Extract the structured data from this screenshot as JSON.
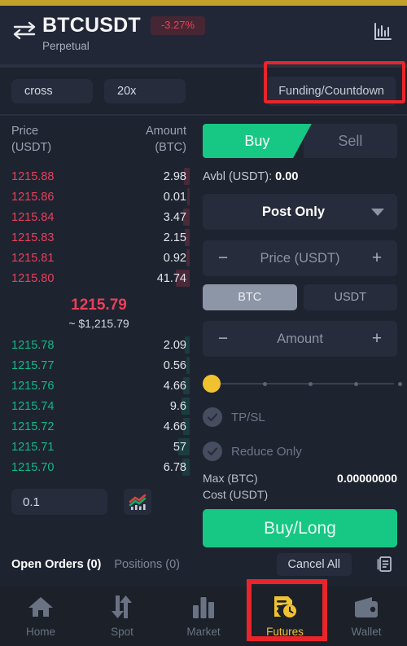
{
  "header": {
    "swap_icon": "swap-icon",
    "symbol": "BTCUSDT",
    "change_badge": "-3.27%",
    "contract_type": "Perpetual",
    "chart_icon": "bar-chart-icon"
  },
  "leverage_bar": {
    "margin_mode": "cross",
    "leverage": "20x",
    "funding_label": "Funding/Countdown"
  },
  "orderbook": {
    "col_price_line1": "Price",
    "col_price_line2": "(USDT)",
    "col_amount_line1": "Amount",
    "col_amount_line2": "(BTC)",
    "asks": [
      {
        "price": "1215.88",
        "amount": "2.98",
        "depth": 7
      },
      {
        "price": "1215.86",
        "amount": "0.01",
        "depth": 3
      },
      {
        "price": "1215.84",
        "amount": "3.47",
        "depth": 8
      },
      {
        "price": "1215.83",
        "amount": "2.15",
        "depth": 6
      },
      {
        "price": "1215.81",
        "amount": "0.92",
        "depth": 4
      },
      {
        "price": "1215.80",
        "amount": "41.74",
        "depth": 17
      }
    ],
    "last_price": "1215.79",
    "last_price_usd": "~ $1,215.79",
    "bids": [
      {
        "price": "1215.78",
        "amount": "2.09",
        "depth": 6
      },
      {
        "price": "1215.77",
        "amount": "0.56",
        "depth": 4
      },
      {
        "price": "1215.76",
        "amount": "4.66",
        "depth": 8
      },
      {
        "price": "1215.74",
        "amount": "9.6",
        "depth": 10
      },
      {
        "price": "1215.72",
        "amount": "4.66",
        "depth": 8
      },
      {
        "price": "1215.71",
        "amount": "57",
        "depth": 14
      },
      {
        "price": "1215.70",
        "amount": "6.78",
        "depth": 9
      }
    ],
    "tick_size": "0.1",
    "depth_icon": "candlestick-depth-icon"
  },
  "trade_form": {
    "buy_tab": "Buy",
    "sell_tab": "Sell",
    "available_label": "Avbl (USDT):",
    "available_value": "0.00",
    "order_type": "Post Only",
    "price_placeholder": "Price (USDT)",
    "minus": "−",
    "plus": "+",
    "ccy_btc": "BTC",
    "ccy_usdt": "USDT",
    "amount_placeholder": "Amount",
    "slider_percent": 0,
    "tpsl_label": "TP/SL",
    "reduce_only_label": "Reduce Only",
    "max_label": "Max (BTC)",
    "max_value": "0.00000000",
    "cost_label": "Cost (USDT)",
    "cost_value": "",
    "submit_label": "Buy/Long"
  },
  "orders_bar": {
    "open_orders_tab": "Open Orders (0)",
    "positions_tab": "Positions (0)",
    "cancel_all": "Cancel All",
    "list_icon": "order-history-icon"
  },
  "bottom_nav": [
    {
      "label": "Home",
      "icon": "home-icon",
      "active": false
    },
    {
      "label": "Spot",
      "icon": "swap-arrows-icon",
      "active": false
    },
    {
      "label": "Market",
      "icon": "bars-icon",
      "active": false
    },
    {
      "label": "Futures",
      "icon": "futures-clock-doc-icon",
      "active": true
    },
    {
      "label": "Wallet",
      "icon": "wallet-icon",
      "active": false
    }
  ],
  "colors": {
    "gold_strip": "#C3A029",
    "background": "#1E2330",
    "panel": "#262C3B",
    "buy_green": "#17C784",
    "sell_red": "#E8415A",
    "bid_green": "#12B886",
    "accent_yellow": "#F0C230",
    "annotation_red": "#E8252B"
  }
}
